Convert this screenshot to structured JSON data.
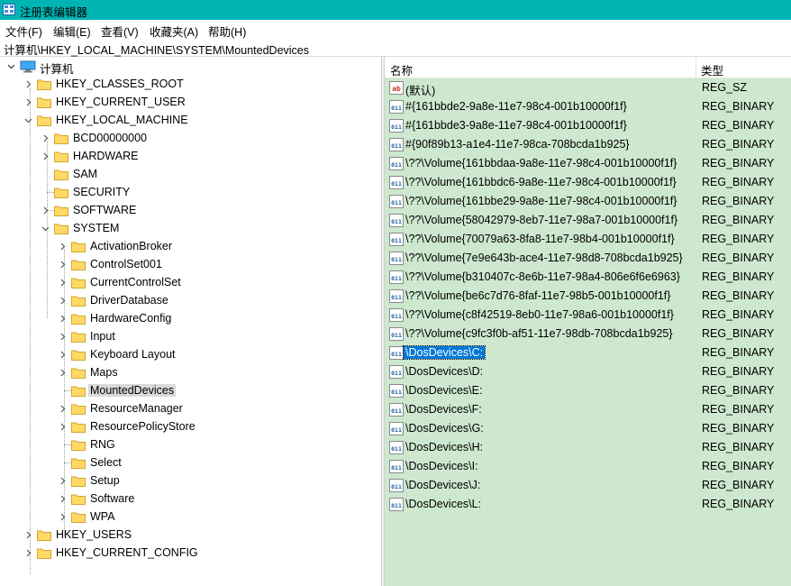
{
  "window": {
    "title": "注册表编辑器"
  },
  "menu": [
    {
      "label": "文件(F)"
    },
    {
      "label": "编辑(E)"
    },
    {
      "label": "查看(V)"
    },
    {
      "label": "收藏夹(A)"
    },
    {
      "label": "帮助(H)"
    }
  ],
  "address": "计算机\\HKEY_LOCAL_MACHINE\\SYSTEM\\MountedDevices",
  "tree": {
    "root": "计算机",
    "hives": [
      {
        "label": "HKEY_CLASSES_ROOT"
      },
      {
        "label": "HKEY_CURRENT_USER"
      },
      {
        "label": "HKEY_LOCAL_MACHINE"
      },
      {
        "label": "HKEY_USERS"
      },
      {
        "label": "HKEY_CURRENT_CONFIG"
      }
    ],
    "hklm_children": [
      {
        "label": "BCD00000000"
      },
      {
        "label": "HARDWARE"
      },
      {
        "label": "SAM"
      },
      {
        "label": "SECURITY"
      },
      {
        "label": "SOFTWARE"
      },
      {
        "label": "SYSTEM"
      }
    ],
    "system_children": [
      {
        "label": "ActivationBroker"
      },
      {
        "label": "ControlSet001"
      },
      {
        "label": "CurrentControlSet"
      },
      {
        "label": "DriverDatabase"
      },
      {
        "label": "HardwareConfig"
      },
      {
        "label": "Input"
      },
      {
        "label": "Keyboard Layout"
      },
      {
        "label": "Maps"
      },
      {
        "label": "MountedDevices"
      },
      {
        "label": "ResourceManager"
      },
      {
        "label": "ResourcePolicyStore"
      },
      {
        "label": "RNG"
      },
      {
        "label": "Select"
      },
      {
        "label": "Setup"
      },
      {
        "label": "Software"
      },
      {
        "label": "WPA"
      }
    ]
  },
  "list": {
    "columns": {
      "name": "名称",
      "type": "类型"
    },
    "rows": [
      {
        "name": "(默认)",
        "type": "REG_SZ",
        "icon": "string-value-icon"
      },
      {
        "name": "#{161bbde2-9a8e-11e7-98c4-001b10000f1f}",
        "type": "REG_BINARY",
        "icon": "binary-value-icon"
      },
      {
        "name": "#{161bbde3-9a8e-11e7-98c4-001b10000f1f}",
        "type": "REG_BINARY",
        "icon": "binary-value-icon"
      },
      {
        "name": "#{90f89b13-a1e4-11e7-98ca-708bcda1b925}",
        "type": "REG_BINARY",
        "icon": "binary-value-icon"
      },
      {
        "name": "\\??\\Volume{161bbdaa-9a8e-11e7-98c4-001b10000f1f}",
        "type": "REG_BINARY",
        "icon": "binary-value-icon"
      },
      {
        "name": "\\??\\Volume{161bbdc6-9a8e-11e7-98c4-001b10000f1f}",
        "type": "REG_BINARY",
        "icon": "binary-value-icon"
      },
      {
        "name": "\\??\\Volume{161bbe29-9a8e-11e7-98c4-001b10000f1f}",
        "type": "REG_BINARY",
        "icon": "binary-value-icon"
      },
      {
        "name": "\\??\\Volume{58042979-8eb7-11e7-98a7-001b10000f1f}",
        "type": "REG_BINARY",
        "icon": "binary-value-icon"
      },
      {
        "name": "\\??\\Volume{70079a63-8fa8-11e7-98b4-001b10000f1f}",
        "type": "REG_BINARY",
        "icon": "binary-value-icon"
      },
      {
        "name": "\\??\\Volume{7e9e643b-ace4-11e7-98d8-708bcda1b925}",
        "type": "REG_BINARY",
        "icon": "binary-value-icon"
      },
      {
        "name": "\\??\\Volume{b310407c-8e6b-11e7-98a4-806e6f6e6963}",
        "type": "REG_BINARY",
        "icon": "binary-value-icon"
      },
      {
        "name": "\\??\\Volume{be6c7d76-8faf-11e7-98b5-001b10000f1f}",
        "type": "REG_BINARY",
        "icon": "binary-value-icon"
      },
      {
        "name": "\\??\\Volume{c8f42519-8eb0-11e7-98a6-001b10000f1f}",
        "type": "REG_BINARY",
        "icon": "binary-value-icon"
      },
      {
        "name": "\\??\\Volume{c9fc3f0b-af51-11e7-98db-708bcda1b925}",
        "type": "REG_BINARY",
        "icon": "binary-value-icon"
      },
      {
        "name": "\\DosDevices\\C:",
        "type": "REG_BINARY",
        "icon": "binary-value-icon",
        "selected": true
      },
      {
        "name": "\\DosDevices\\D:",
        "type": "REG_BINARY",
        "icon": "binary-value-icon"
      },
      {
        "name": "\\DosDevices\\E:",
        "type": "REG_BINARY",
        "icon": "binary-value-icon"
      },
      {
        "name": "\\DosDevices\\F:",
        "type": "REG_BINARY",
        "icon": "binary-value-icon"
      },
      {
        "name": "\\DosDevices\\G:",
        "type": "REG_BINARY",
        "icon": "binary-value-icon"
      },
      {
        "name": "\\DosDevices\\H:",
        "type": "REG_BINARY",
        "icon": "binary-value-icon"
      },
      {
        "name": "\\DosDevices\\I:",
        "type": "REG_BINARY",
        "icon": "binary-value-icon"
      },
      {
        "name": "\\DosDevices\\J:",
        "type": "REG_BINARY",
        "icon": "binary-value-icon"
      },
      {
        "name": "\\DosDevices\\L:",
        "type": "REG_BINARY",
        "icon": "binary-value-icon"
      }
    ]
  },
  "colors": {
    "titlebar": "#00b4b4",
    "list_background": "#cde8cf",
    "selection": "#0078d7",
    "tree_selection": "#d9d9d9",
    "folder": "#ffd966"
  }
}
